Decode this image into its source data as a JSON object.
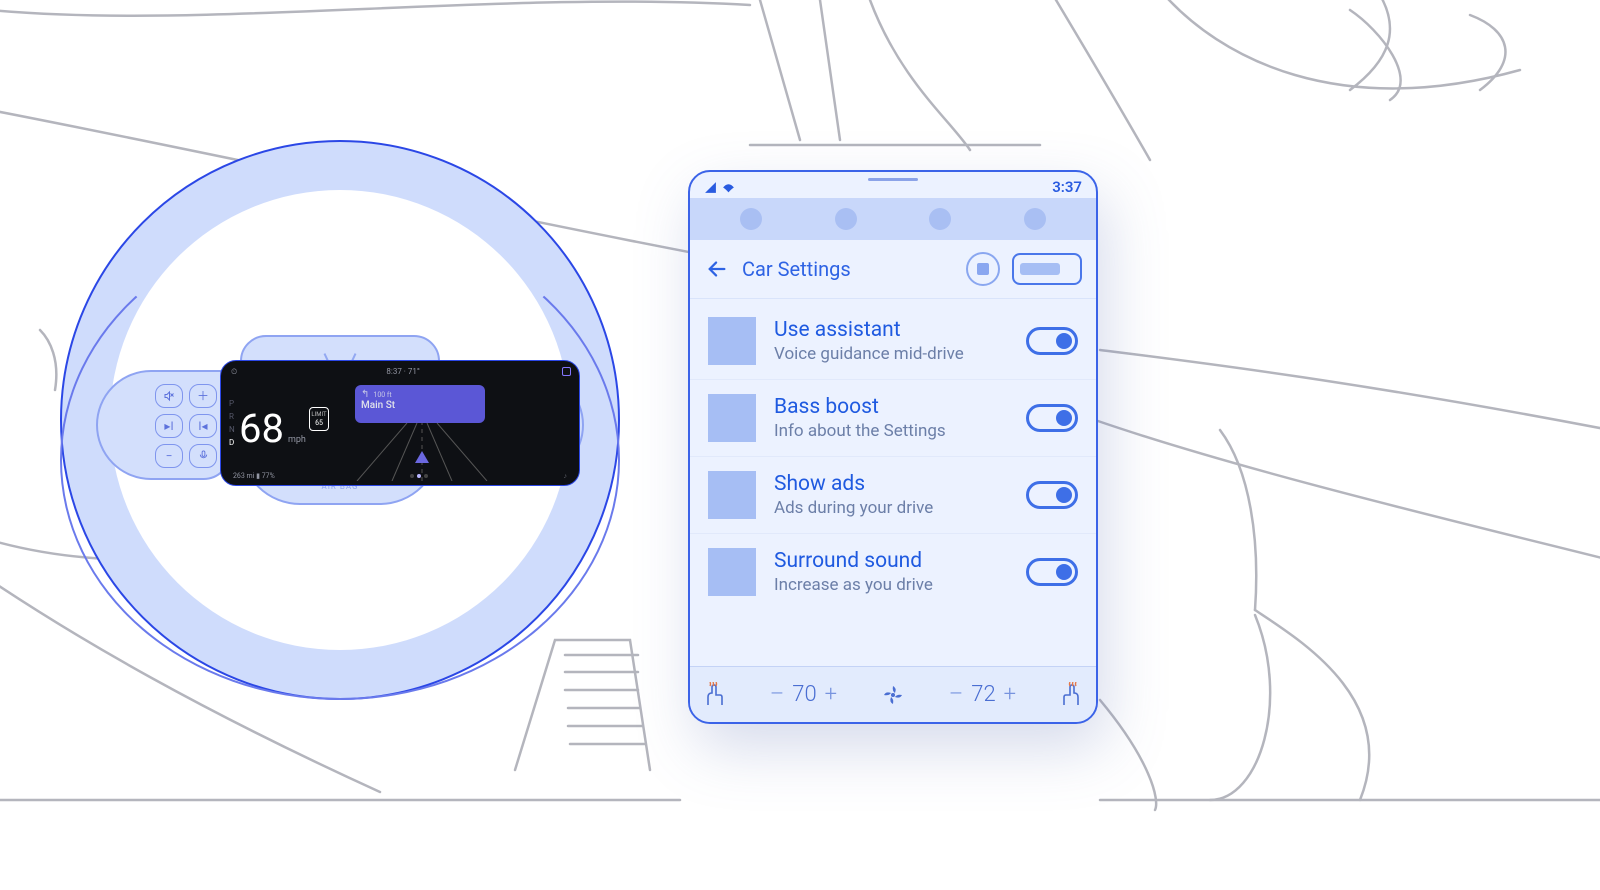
{
  "statusbar": {
    "time": "3:37"
  },
  "header": {
    "title": "Car Settings"
  },
  "settings": [
    {
      "title": "Use assistant",
      "subtitle": "Voice guidance mid-drive"
    },
    {
      "title": "Bass boost",
      "subtitle": "Info about the Settings"
    },
    {
      "title": "Show ads",
      "subtitle": "Ads during your drive"
    },
    {
      "title": "Surround sound",
      "subtitle": "Increase as you drive"
    }
  ],
  "hvac": {
    "left_temp": "70",
    "right_temp": "72",
    "minus": "–",
    "plus": "+"
  },
  "cluster": {
    "time_temp": "8:37 · 71°",
    "speed": "68",
    "speed_unit": "mph",
    "limit_top": "65",
    "nav_dist": "100 ft",
    "nav_road": "Main St",
    "gears": [
      "P",
      "R",
      "N",
      "D"
    ],
    "gear_active": "D",
    "range": "263 mi",
    "battery": "77%",
    "airbag": "AIR BAG"
  }
}
